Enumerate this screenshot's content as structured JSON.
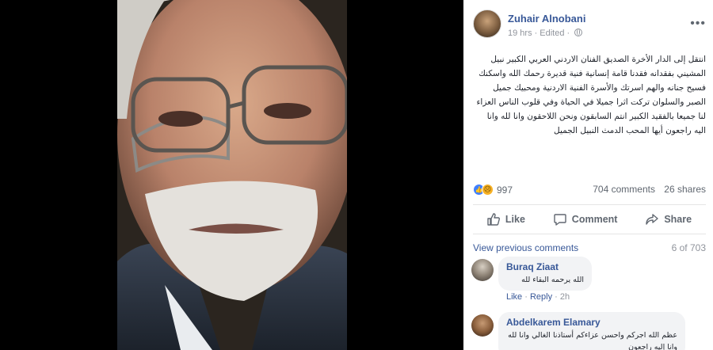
{
  "post": {
    "author": "Zuhair Alnobani",
    "time": "19 hrs",
    "edited": "Edited",
    "text": "انتقل إلى الدار الأخرة الصديق الفنان الاردني العربي الكبير نبيل المشيني بفقدانه فقدنا قامة إنسانية فنية قديرة رحمك الله واسكنك فسيح جنانه والهم اسرتك والأسرة الفنية الاردنية ومحبيك جميل الصبر والسلوان تركت اثرا جميلا في الحياة وفي قلوب الناس العزاء لنا جميعا بالفقيد الكبير انتم السابقون ونحن اللاحقون وانا لله وانا اليه راجعون أيها المحب الدمث النبيل الجميل",
    "icons": {
      "reaction1": "like-icon",
      "reaction2": "sad-icon",
      "privacy": "globe-icon"
    },
    "reaction_count": "997",
    "comments_count": "704 comments",
    "shares_count": "26 shares"
  },
  "actions": {
    "like": "Like",
    "comment": "Comment",
    "share": "Share"
  },
  "comments_section": {
    "view_previous": "View previous comments",
    "count": "6 of 703",
    "items": [
      {
        "name": "Buraq Ziaat",
        "text": "الله يرحمه البقاء لله",
        "like": "Like",
        "reply": "Reply",
        "time": "2h"
      },
      {
        "name": "Abdelkarem Elamary",
        "text": "عظم الله اجركم واحسن عزاءكم أستاذنا الغالي وانا لله وانا إليه راجعون"
      }
    ]
  },
  "colors": {
    "link": "#385898",
    "muted": "#90949c",
    "like_blue": "#4080ff",
    "sad_yellow": "#f7b125"
  }
}
